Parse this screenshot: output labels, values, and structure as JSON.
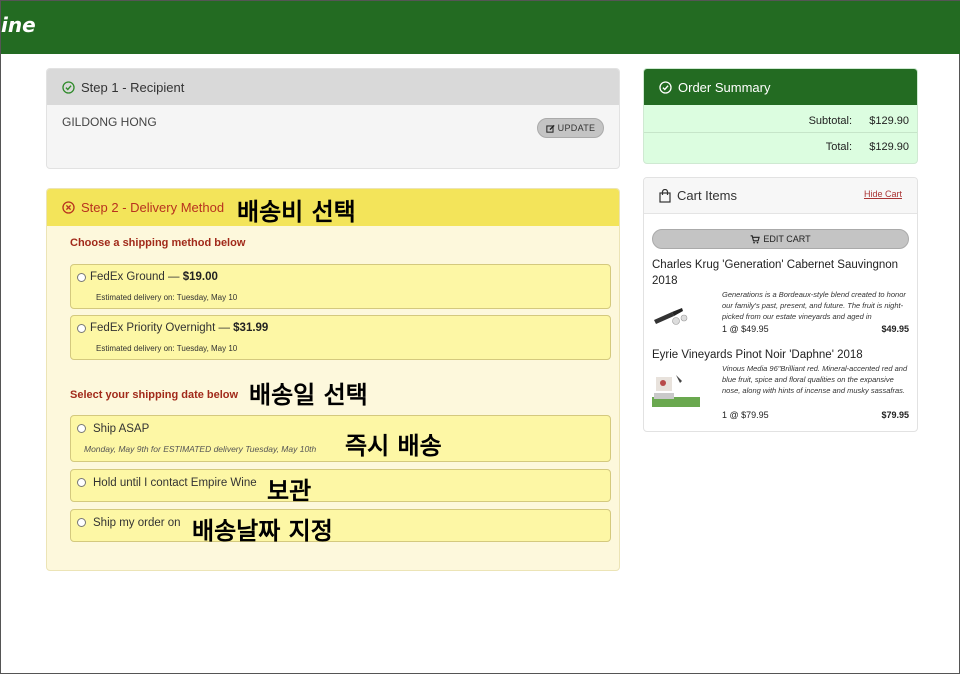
{
  "header": {
    "logo_text": "ine",
    "bg_color": "#236b22"
  },
  "step1": {
    "title": "Step 1 - Recipient",
    "recipient": "GILDONG HONG",
    "update_label": "UPDATE"
  },
  "step2": {
    "title": "Step 2 - Delivery Method",
    "annotation": "배송비 선택",
    "shipping_heading": "Choose a shipping method below",
    "methods": [
      {
        "name": "FedEx Ground — ",
        "price": "$19.00",
        "estimate": "Estimated delivery on: Tuesday, May 10"
      },
      {
        "name": "FedEx Priority Overnight — ",
        "price": "$31.99",
        "estimate": "Estimated delivery on: Tuesday, May 10"
      }
    ],
    "date_heading": "Select your shipping date below",
    "date_annotation": "배송일 선택",
    "date_options": [
      {
        "label": "Ship ASAP",
        "note": "Monday, May 9th for ESTIMATED delivery Tuesday, May 10th",
        "annotation": "즉시 배송"
      },
      {
        "label": "Hold until I contact Empire Wine",
        "annotation": "보관"
      },
      {
        "label": "Ship my order on",
        "annotation": "배송날짜 지정"
      }
    ]
  },
  "summary": {
    "title": "Order Summary",
    "subtotal_label": "Subtotal:",
    "subtotal": "$129.90",
    "total_label": "Total:",
    "total": "$129.90"
  },
  "cart": {
    "title": "Cart Items",
    "hide_label": "Hide Cart",
    "edit_label": "EDIT CART",
    "items": [
      {
        "name": "Charles Krug 'Generation' Cabernet Sauvingnon 2018",
        "description": "Generations is a Bordeaux-style blend created to honor our family's past, present, and future. The fruit is night-picked from our estate vineyards and aged in",
        "qty_price": "1 @ $49.95",
        "total": "$49.95"
      },
      {
        "name": "Eyrie Vineyards Pinot Noir 'Daphne' 2018",
        "description": "Vinous Media 96\"Brilliant red. Mineral-accented red and blue fruit, spice and floral qualities on the expansive nose, along with hints of incense and musky sassafras.",
        "qty_price": "1 @ $79.95",
        "total": "$79.95"
      }
    ]
  }
}
